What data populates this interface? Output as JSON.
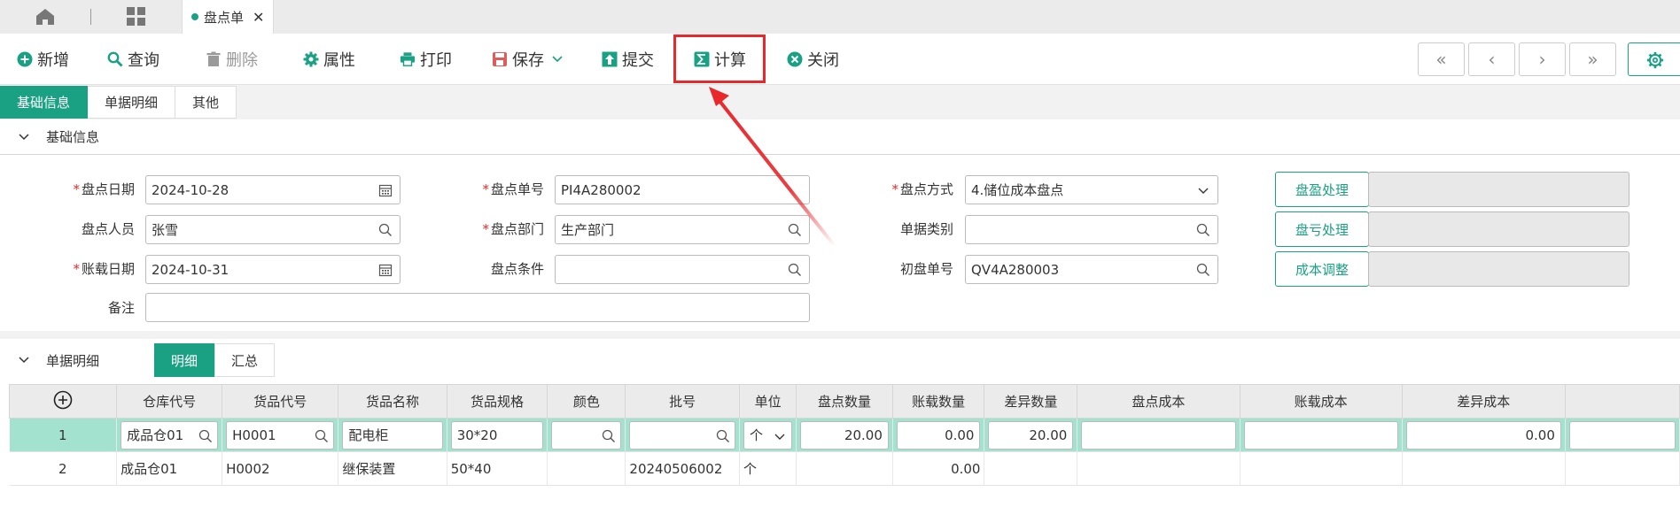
{
  "tabs": {
    "doc_tab_label": "盘点单",
    "doc_tab_close": "✕"
  },
  "toolbar": {
    "new": "新增",
    "query": "查询",
    "delete": "删除",
    "properties": "属性",
    "print": "打印",
    "save": "保存",
    "submit": "提交",
    "calculate": "计算",
    "close": "关闭",
    "nav_first": "«",
    "nav_prev": "‹",
    "nav_next": "›",
    "nav_last": "»"
  },
  "section_tabs": [
    "基础信息",
    "单据明细",
    "其他"
  ],
  "basic": {
    "title": "基础信息",
    "fields": {
      "check_date_label": "盘点日期",
      "check_date": "2024-10-28",
      "check_no_label": "盘点单号",
      "check_no": "PI4A280002",
      "check_method_label": "盘点方式",
      "check_method": "4.储位成本盘点",
      "checker_label": "盘点人员",
      "checker": "张雪",
      "dept_label": "盘点部门",
      "dept": "生产部门",
      "doc_type_label": "单据类别",
      "doc_type": "",
      "post_date_label": "账载日期",
      "post_date": "2024-10-31",
      "condition_label": "盘点条件",
      "condition": "",
      "init_no_label": "初盘单号",
      "init_no": "QV4A280003",
      "remark_label": "备注",
      "remark": ""
    },
    "buttons": {
      "surplus": "盘盈处理",
      "loss": "盘亏处理",
      "cost_adjust": "成本调整"
    }
  },
  "detail": {
    "title": "单据明细",
    "sub_tabs": [
      "明细",
      "汇总"
    ],
    "columns": [
      "仓库代号",
      "货品代号",
      "货品名称",
      "货品规格",
      "颜色",
      "批号",
      "单位",
      "盘点数量",
      "账载数量",
      "差异数量",
      "盘点成本",
      "账载成本",
      "差异成本"
    ],
    "rows": [
      {
        "idx": "1",
        "wh": "成品仓01",
        "code": "H0001",
        "name": "配电柜",
        "spec": "30*20",
        "color": "",
        "batch": "",
        "unit": "个",
        "qty": "20.00",
        "book_qty": "0.00",
        "diff_qty": "20.00",
        "cost": "",
        "book_cost": "",
        "diff_cost": "0.00"
      },
      {
        "idx": "2",
        "wh": "成品仓01",
        "code": "H0002",
        "name": "继保装置",
        "spec": "50*40",
        "color": "",
        "batch": "20240506002",
        "unit": "个",
        "qty": "",
        "book_qty": "0.00",
        "diff_qty": "",
        "cost": "",
        "book_cost": "",
        "diff_cost": ""
      }
    ]
  },
  "colors": {
    "accent": "#1aa184",
    "highlight": "#e8282b",
    "row_selected": "#a3e2cf"
  }
}
